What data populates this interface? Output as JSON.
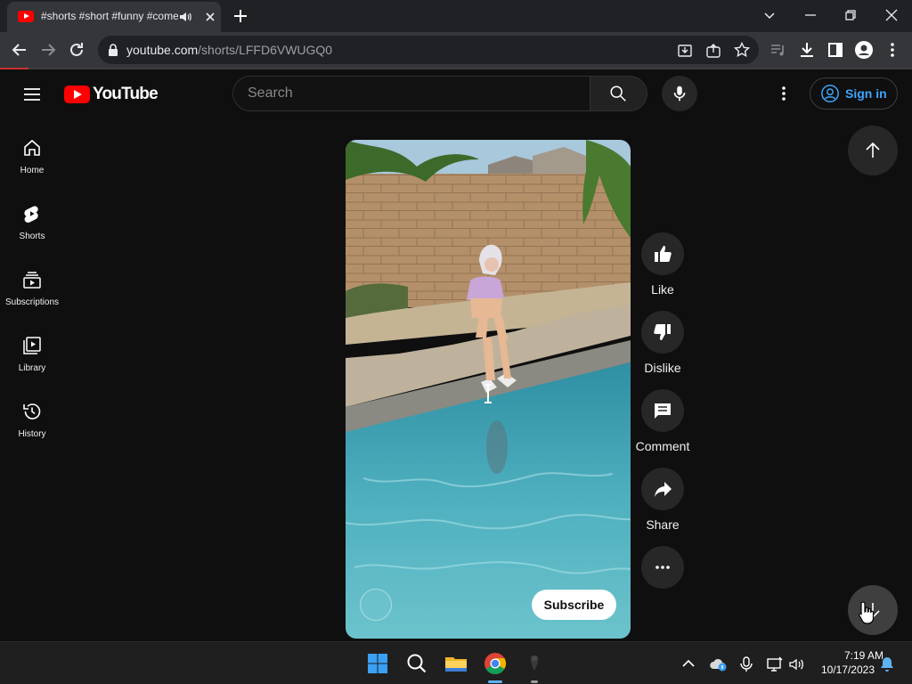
{
  "browser": {
    "tab_title": "#shorts #short #funny #comedy",
    "url_host": "youtube.com",
    "url_path": "/shorts/LFFD6VWUGQ0"
  },
  "header": {
    "logo_text": "YouTube",
    "search_placeholder": "Search",
    "signin_label": "Sign in"
  },
  "sidebar": {
    "items": [
      {
        "label": "Home",
        "icon": "home-icon"
      },
      {
        "label": "Shorts",
        "icon": "shorts-icon"
      },
      {
        "label": "Subscriptions",
        "icon": "subscriptions-icon"
      },
      {
        "label": "Library",
        "icon": "library-icon"
      },
      {
        "label": "History",
        "icon": "history-icon"
      }
    ]
  },
  "player": {
    "subscribe_label": "Subscribe"
  },
  "actions": {
    "like": "Like",
    "dislike": "Dislike",
    "comment": "Comment",
    "share": "Share"
  },
  "taskbar": {
    "time": "7:19 AM",
    "date": "10/17/2023"
  },
  "colors": {
    "page_bg": "#0f0f0f",
    "accent_red": "#ff0000",
    "link_blue": "#3ea6ff",
    "action_bg": "#272727"
  }
}
